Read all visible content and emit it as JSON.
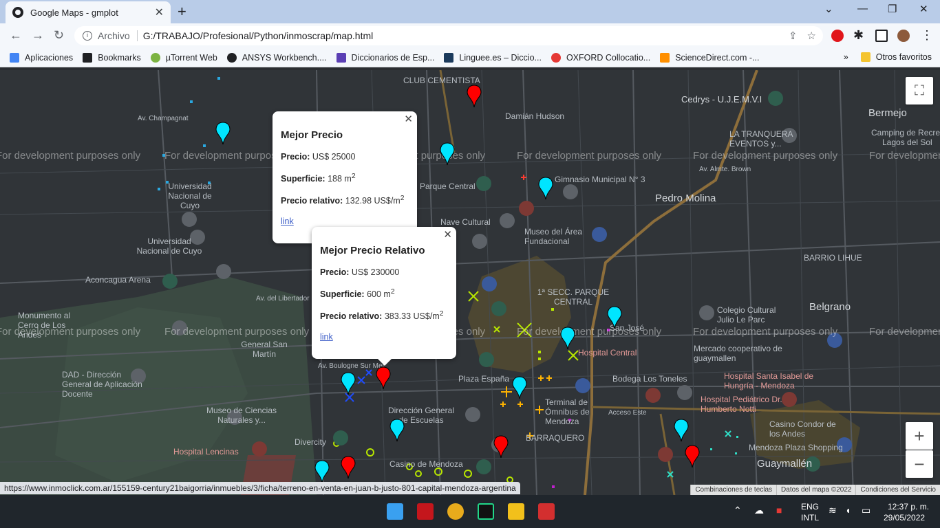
{
  "browser": {
    "tab_title": "Google Maps - gmplot",
    "tab_close": "✕",
    "new_tab": "+",
    "url_scheme": "Archivo",
    "url": "G:/TRABAJO/Profesional/Python/inmoscrap/map.html",
    "status_url": "https://www.inmoclick.com.ar/155159-century21baigorria/inmuebles/3/ficha/terreno-en-venta-en-juan-b-justo-801-capital-mendoza-argentina"
  },
  "bookmarks": {
    "items": [
      {
        "label": "Aplicaciones",
        "icon": "apps-grid-icon",
        "color": "#4285f4"
      },
      {
        "label": "Bookmarks",
        "icon": "star-icon",
        "color": "#202124"
      },
      {
        "label": "µTorrent Web",
        "icon": "utorrent-icon",
        "color": "#7cb342"
      },
      {
        "label": "ANSYS Workbench....",
        "icon": "globe-icon",
        "color": "#202124"
      },
      {
        "label": "Diccionarios de Esp...",
        "icon": "wordreference-icon",
        "color": "#5b3fb4"
      },
      {
        "label": "Linguee.es – Diccio...",
        "icon": "linguee-icon",
        "color": "#1b3a5c"
      },
      {
        "label": "OXFORD Collocatio...",
        "icon": "oxford-icon",
        "color": "#e53935"
      },
      {
        "label": "ScienceDirect.com -...",
        "icon": "elsevier-icon",
        "color": "#ff8f00"
      }
    ],
    "overflow": "»",
    "other_favorites": "Otros favoritos"
  },
  "map": {
    "watermark": "For development purposes only",
    "labels": [
      {
        "text": "CLUB CEMENTISTA",
        "kind": "normal"
      },
      {
        "text": "Damián Hudson",
        "kind": "normal"
      },
      {
        "text": "Cedrys - U.J.E.M.V.I",
        "kind": "normal"
      },
      {
        "text": "Bermejo",
        "kind": "big"
      },
      {
        "text": "Camping de Recreo",
        "kind": "normal"
      },
      {
        "text": "Lagos del Sol",
        "kind": "normal"
      },
      {
        "text": "LA TRANQUERA",
        "kind": "normal"
      },
      {
        "text": "EVENTOS y...",
        "kind": "normal"
      },
      {
        "text": "Gimnasio Municipal N° 3",
        "kind": "normal"
      },
      {
        "text": "Pedro Molina",
        "kind": "big"
      },
      {
        "text": "Universidad Nacional de Cuyo",
        "kind": "normal"
      },
      {
        "text": "Universidad Nacional de Cuyo",
        "kind": "normal"
      },
      {
        "text": "Parque Central",
        "kind": "normal"
      },
      {
        "text": "Nave Cultural",
        "kind": "normal"
      },
      {
        "text": "Museo del Área Fundacional",
        "kind": "normal"
      },
      {
        "text": "BARRIO LIHUE",
        "kind": "normal"
      },
      {
        "text": "Aconcagua Arena",
        "kind": "normal"
      },
      {
        "text": "1ª SECC. PARQUE CENTRAL",
        "kind": "normal"
      },
      {
        "text": "Belgrano",
        "kind": "big"
      },
      {
        "text": "Colegio Cultural Julio Le Parc",
        "kind": "normal"
      },
      {
        "text": "Mercado cooperativo de guaymallen",
        "kind": "normal"
      },
      {
        "text": "Monumento al Cerro de Los Andes",
        "kind": "normal"
      },
      {
        "text": "General San Martín",
        "kind": "normal"
      },
      {
        "text": "San José",
        "kind": "normal"
      },
      {
        "text": "Hospital Central",
        "kind": "red"
      },
      {
        "text": "Plaza España",
        "kind": "normal"
      },
      {
        "text": "Bodega Los Toneles",
        "kind": "normal"
      },
      {
        "text": "Hospital Santa Isabel de Hungría - Mendoza",
        "kind": "red"
      },
      {
        "text": "DAD - Dirección General de Aplicación Docente",
        "kind": "normal"
      },
      {
        "text": "Museo de Ciencias Naturales y...",
        "kind": "normal"
      },
      {
        "text": "Dirección General de Escuelas",
        "kind": "normal"
      },
      {
        "text": "Terminal de Ómnibus de Mendoza",
        "kind": "normal"
      },
      {
        "text": "Hospital Pediátrico Dr. Humberto Notti",
        "kind": "red"
      },
      {
        "text": "BARRAQUERO",
        "kind": "normal"
      },
      {
        "text": "Casino Condor de los Andes",
        "kind": "normal"
      },
      {
        "text": "Divercity",
        "kind": "normal"
      },
      {
        "text": "Mendoza Plaza Shopping",
        "kind": "normal"
      },
      {
        "text": "Guaymallén",
        "kind": "big"
      },
      {
        "text": "Hospital Lencinas",
        "kind": "red"
      },
      {
        "text": "Casino de Mendoza",
        "kind": "normal"
      },
      {
        "text": "Acceso Este",
        "kind": "normal"
      },
      {
        "text": "Av. Almte. Brown",
        "kind": "normal"
      },
      {
        "text": "Av. Boulogne Sur Mer",
        "kind": "normal"
      },
      {
        "text": "Av. del Libertador",
        "kind": "normal"
      },
      {
        "text": "Av. Champagnat",
        "kind": "normal"
      }
    ],
    "info_windows": [
      {
        "title": "Mejor Precio",
        "price_label": "Precio:",
        "price_value": "US$ 25000",
        "area_label": "Superficie:",
        "area_value": "188 m",
        "area_unit_exp": "2",
        "rel_label": "Precio relativo:",
        "rel_value": "132.98 US$/m",
        "rel_unit_exp": "2",
        "link": "link",
        "close": "✕"
      },
      {
        "title": "Mejor Precio Relativo",
        "price_label": "Precio:",
        "price_value": "US$ 230000",
        "area_label": "Superficie:",
        "area_value": "600 m",
        "area_unit_exp": "2",
        "rel_label": "Precio relativo:",
        "rel_value": "383.33 US$/m",
        "rel_unit_exp": "2",
        "link": "link",
        "close": "✕"
      }
    ],
    "zoom_in": "+",
    "zoom_out": "−",
    "attribution": [
      "Combinaciones de teclas",
      "Datos del mapa ©2022",
      "Condiciones del Servicio"
    ],
    "colors": {
      "pin_cyan": "#00e5ff",
      "pin_red": "#ff0000",
      "marker_blue": "#1f4cff",
      "marker_yellowgreen": "#b8e600",
      "marker_orange": "#ffb300",
      "marker_teal": "#2fe0c8",
      "marker_magenta": "#c020d0"
    }
  },
  "taskbar": {
    "lang_top": "ENG",
    "lang_bottom": "INTL",
    "time": "12:37 p. m.",
    "date": "29/05/2022",
    "icons": [
      "windows-start-icon",
      "mendeley-icon",
      "chrome-icon",
      "pycharm-icon",
      "file-explorer-icon",
      "app-icon"
    ]
  }
}
